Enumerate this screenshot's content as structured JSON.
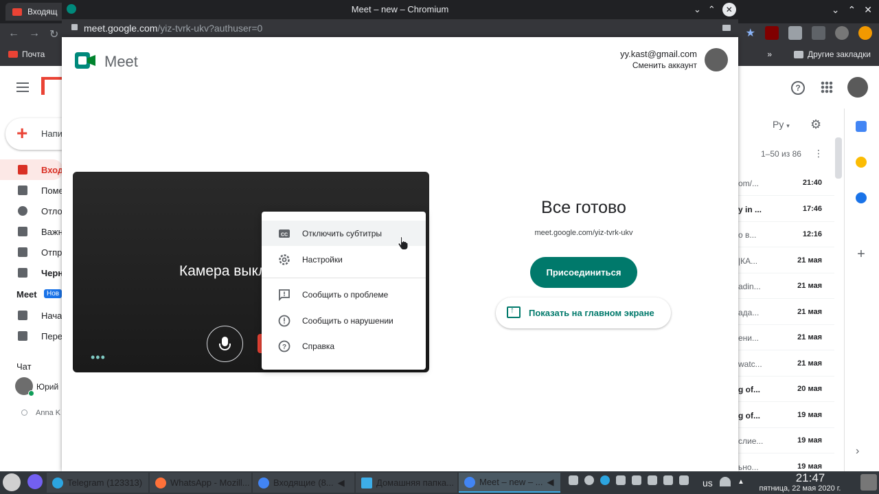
{
  "background_browser": {
    "tab_title": "Входящ",
    "bookmarks": {
      "mail": "Почта",
      "other": "Другие закладки"
    }
  },
  "gmail": {
    "compose": "Напи",
    "nav": [
      {
        "label": "Вход",
        "active": true
      },
      {
        "label": "Поме"
      },
      {
        "label": "Отло"
      },
      {
        "label": "Важн"
      },
      {
        "label": "Отпр"
      },
      {
        "label": "Черн"
      }
    ],
    "meet_section": {
      "title": "Meet",
      "badge": "Нов",
      "items": [
        "Нача",
        "Пере"
      ]
    },
    "chat": {
      "title": "Чат",
      "users": [
        "Юрий",
        "Anna K"
      ]
    },
    "header": {
      "lang": "Ру",
      "pager": "1–50 из 86"
    },
    "rows": [
      {
        "snippet": "om/...",
        "date": "21:40"
      },
      {
        "snippet": "y in ...",
        "date": "17:46"
      },
      {
        "snippet": "о в...",
        "date": "12:16"
      },
      {
        "snippet": "|КА...",
        "date": "21 мая"
      },
      {
        "snippet": "adin...",
        "date": "21 мая"
      },
      {
        "snippet": "ада...",
        "date": "21 мая"
      },
      {
        "snippet": "ени...",
        "date": "21 мая"
      },
      {
        "snippet": "watc...",
        "date": "21 мая"
      },
      {
        "snippet": "g of...",
        "date": "20 мая"
      },
      {
        "snippet": "g of...",
        "date": "19 мая"
      },
      {
        "snippet": "слие...",
        "date": "19 мая"
      },
      {
        "snippet": "ьно...",
        "date": "19 мая"
      }
    ]
  },
  "meet_window": {
    "title": "Meet – new – Chromium",
    "url_host": "meet.google.com",
    "url_path": "/yiz-tvrk-ukv?authuser=0",
    "brand": "Meet",
    "account": {
      "email": "yy.kast@gmail.com",
      "switch": "Сменить аккаунт"
    },
    "preview": {
      "camera_off_text": "Камера выключена",
      "more_dots": "•••"
    },
    "menu": [
      {
        "label": "Отключить субтитры",
        "icon": "cc-icon"
      },
      {
        "label": "Настройки",
        "icon": "gear-icon"
      },
      {
        "label": "Сообщить о проблеме",
        "icon": "feedback-icon"
      },
      {
        "label": "Сообщить о нарушении",
        "icon": "report-icon"
      },
      {
        "label": "Справка",
        "icon": "help-icon"
      }
    ],
    "ready_title": "Все готово",
    "meeting_url": "meet.google.com/yiz-tvrk-ukv",
    "join_label": "Присоединиться",
    "present_label": "Показать на главном экране",
    "accent_color": "#00796b"
  },
  "taskbar": {
    "tasks": [
      {
        "label": "Telegram (123313)"
      },
      {
        "label": "WhatsApp - Mozill..."
      },
      {
        "label": "Входящие (8..."
      },
      {
        "label": "Домашняя папка..."
      },
      {
        "label": "Meet – new – ...",
        "active": true
      }
    ],
    "lang": "us",
    "time": "21:47",
    "date": "пятница, 22 мая 2020 г."
  }
}
